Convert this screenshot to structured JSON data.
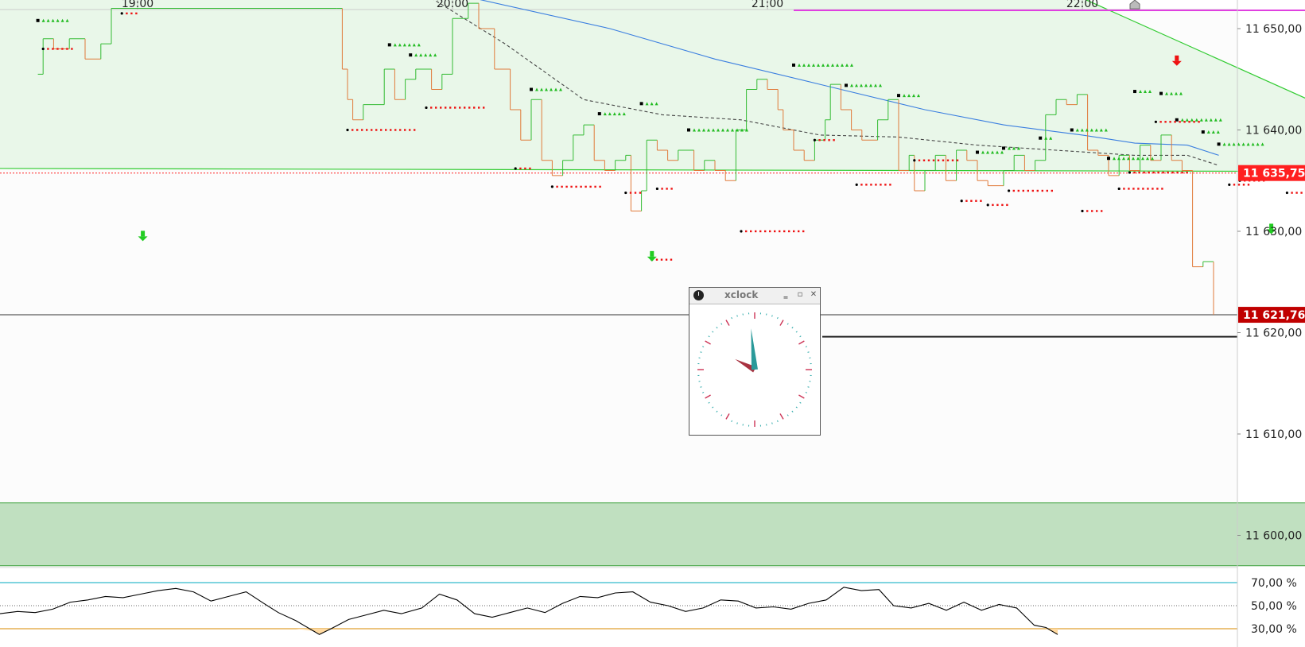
{
  "chart_data": {
    "type": "line",
    "time_axis": {
      "ticks": [
        "19:00",
        "20:00",
        "21:00",
        "22:00"
      ]
    },
    "price_axis": {
      "ticks": [
        "11 650,00",
        "11 640,00",
        "11 630,00",
        "11 620,00",
        "11 610,00",
        "11 600,00"
      ],
      "tick_values": [
        11650,
        11640,
        11630,
        11620,
        11610,
        11600
      ],
      "range": [
        11597,
        11653
      ],
      "current_price_label": "11 621,76",
      "reference_price_label": "11 635,75",
      "current_price": 11621.76,
      "reference_price": 11635.75,
      "support_level": 11619.6
    },
    "price_series": [
      {
        "t": "18:41",
        "v": 11645.5
      },
      {
        "t": "18:42",
        "v": 11649
      },
      {
        "t": "18:44",
        "v": 11648
      },
      {
        "t": "18:47",
        "v": 11649
      },
      {
        "t": "18:50",
        "v": 11647
      },
      {
        "t": "18:53",
        "v": 11648.5
      },
      {
        "t": "18:55",
        "v": 11652
      },
      {
        "t": "19:38",
        "v": 11652
      },
      {
        "t": "19:39",
        "v": 11646
      },
      {
        "t": "19:40",
        "v": 11643
      },
      {
        "t": "19:41",
        "v": 11641
      },
      {
        "t": "19:43",
        "v": 11642.5
      },
      {
        "t": "19:47",
        "v": 11646
      },
      {
        "t": "19:49",
        "v": 11643
      },
      {
        "t": "19:51",
        "v": 11645
      },
      {
        "t": "19:53",
        "v": 11646
      },
      {
        "t": "19:56",
        "v": 11644
      },
      {
        "t": "19:58",
        "v": 11645.5
      },
      {
        "t": "20:00",
        "v": 11651
      },
      {
        "t": "20:03",
        "v": 11652.5
      },
      {
        "t": "20:05",
        "v": 11650
      },
      {
        "t": "20:08",
        "v": 11646
      },
      {
        "t": "20:11",
        "v": 11642
      },
      {
        "t": "20:13",
        "v": 11639
      },
      {
        "t": "20:15",
        "v": 11643
      },
      {
        "t": "20:17",
        "v": 11637
      },
      {
        "t": "20:19",
        "v": 11635.5
      },
      {
        "t": "20:21",
        "v": 11637
      },
      {
        "t": "20:23",
        "v": 11639.5
      },
      {
        "t": "20:25",
        "v": 11640.5
      },
      {
        "t": "20:27",
        "v": 11637
      },
      {
        "t": "20:29",
        "v": 11636
      },
      {
        "t": "20:31",
        "v": 11637
      },
      {
        "t": "20:33",
        "v": 11637.5
      },
      {
        "t": "20:34",
        "v": 11632
      },
      {
        "t": "20:36",
        "v": 11634
      },
      {
        "t": "20:37",
        "v": 11639
      },
      {
        "t": "20:39",
        "v": 11638
      },
      {
        "t": "20:41",
        "v": 11637
      },
      {
        "t": "20:43",
        "v": 11638
      },
      {
        "t": "20:46",
        "v": 11636
      },
      {
        "t": "20:48",
        "v": 11637
      },
      {
        "t": "20:50",
        "v": 11636
      },
      {
        "t": "20:52",
        "v": 11635
      },
      {
        "t": "20:54",
        "v": 11640
      },
      {
        "t": "20:56",
        "v": 11644
      },
      {
        "t": "20:58",
        "v": 11645
      },
      {
        "t": "21:00",
        "v": 11644
      },
      {
        "t": "21:02",
        "v": 11642
      },
      {
        "t": "21:03",
        "v": 11640
      },
      {
        "t": "21:05",
        "v": 11638
      },
      {
        "t": "21:07",
        "v": 11637
      },
      {
        "t": "21:09",
        "v": 11639
      },
      {
        "t": "21:11",
        "v": 11641
      },
      {
        "t": "21:12",
        "v": 11644.5
      },
      {
        "t": "21:14",
        "v": 11642
      },
      {
        "t": "21:16",
        "v": 11640
      },
      {
        "t": "21:18",
        "v": 11639
      },
      {
        "t": "21:21",
        "v": 11641
      },
      {
        "t": "21:23",
        "v": 11643
      },
      {
        "t": "21:25",
        "v": 11636
      },
      {
        "t": "21:27",
        "v": 11637.5
      },
      {
        "t": "21:28",
        "v": 11634
      },
      {
        "t": "21:30",
        "v": 11636
      },
      {
        "t": "21:32",
        "v": 11637.5
      },
      {
        "t": "21:34",
        "v": 11635
      },
      {
        "t": "21:36",
        "v": 11638
      },
      {
        "t": "21:38",
        "v": 11637
      },
      {
        "t": "21:40",
        "v": 11635
      },
      {
        "t": "21:42",
        "v": 11634.5
      },
      {
        "t": "21:45",
        "v": 11636
      },
      {
        "t": "21:47",
        "v": 11637.5
      },
      {
        "t": "21:49",
        "v": 11636
      },
      {
        "t": "21:51",
        "v": 11637
      },
      {
        "t": "21:53",
        "v": 11641.5
      },
      {
        "t": "21:55",
        "v": 11643
      },
      {
        "t": "21:57",
        "v": 11642.5
      },
      {
        "t": "21:59",
        "v": 11643.5
      },
      {
        "t": "22:01",
        "v": 11638
      },
      {
        "t": "22:03",
        "v": 11637.5
      },
      {
        "t": "22:05",
        "v": 11635.5
      },
      {
        "t": "22:07",
        "v": 11637.5
      },
      {
        "t": "22:09",
        "v": 11636
      },
      {
        "t": "22:11",
        "v": 11638.5
      },
      {
        "t": "22:13",
        "v": 11637
      },
      {
        "t": "22:15",
        "v": 11639.5
      },
      {
        "t": "22:17",
        "v": 11637
      },
      {
        "t": "22:19",
        "v": 11636
      },
      {
        "t": "22:21",
        "v": 11626.5
      },
      {
        "t": "22:23",
        "v": 11627
      },
      {
        "t": "22:25",
        "v": 11621.76
      }
    ],
    "moving_average_blue": [
      {
        "t": "20:04",
        "v": 11653
      },
      {
        "t": "20:30",
        "v": 11650
      },
      {
        "t": "20:50",
        "v": 11647
      },
      {
        "t": "21:10",
        "v": 11644.5
      },
      {
        "t": "21:30",
        "v": 11642
      },
      {
        "t": "21:45",
        "v": 11640.5
      },
      {
        "t": "22:00",
        "v": 11639.5
      },
      {
        "t": "22:10",
        "v": 11638.7
      },
      {
        "t": "22:20",
        "v": 11638.5
      },
      {
        "t": "22:26",
        "v": 11637.5
      }
    ],
    "moving_average_dashed": [
      {
        "t": "19:56",
        "v": 11653
      },
      {
        "t": "20:10",
        "v": 11648.5
      },
      {
        "t": "20:25",
        "v": 11643
      },
      {
        "t": "20:40",
        "v": 11641.5
      },
      {
        "t": "20:55",
        "v": 11641
      },
      {
        "t": "21:10",
        "v": 11639.5
      },
      {
        "t": "21:25",
        "v": 11639.3
      },
      {
        "t": "21:40",
        "v": 11638.5
      },
      {
        "t": "21:55",
        "v": 11638
      },
      {
        "t": "22:10",
        "v": 11637.5
      },
      {
        "t": "22:20",
        "v": 11637.5
      },
      {
        "t": "22:26",
        "v": 11636.5
      }
    ],
    "trend_channel": {
      "upper": [
        {
          "t": "18:31",
          "v": 11653
        },
        {
          "t": "22:00",
          "v": 11653
        },
        {
          "t": "22:56",
          "v": 11640
        }
      ],
      "lower": [
        {
          "t": "18:31",
          "v": 11636.2
        },
        {
          "t": "22:56",
          "v": 11635.9
        }
      ]
    },
    "target_zone": {
      "t_start": "18:31",
      "t_end": "22:44",
      "low": 11597,
      "high": 11603.2
    },
    "magenta_line": {
      "t_start": "21:05",
      "t_end": "22:56",
      "v": 11653
    },
    "signals": {
      "sell_arrow_red": [
        {
          "t": "22:18",
          "v": 11646.8
        }
      ],
      "sell_arrow_green": [
        {
          "t": "19:01",
          "v": 11629.5
        },
        {
          "t": "20:38",
          "v": 11627.5
        },
        {
          "t": "22:36",
          "v": 11630.2
        }
      ],
      "marker_house": [
        {
          "t": "22:10",
          "v": 11652.5
        }
      ]
    },
    "green_triangle_runs": [
      {
        "t": "18:41",
        "v": 11650.8,
        "n": 6
      },
      {
        "t": "19:48",
        "v": 11648.4,
        "n": 6
      },
      {
        "t": "19:52",
        "v": 11647.4,
        "n": 5
      },
      {
        "t": "20:15",
        "v": 11644,
        "n": 6
      },
      {
        "t": "20:28",
        "v": 11641.6,
        "n": 5
      },
      {
        "t": "20:36",
        "v": 11642.6,
        "n": 3
      },
      {
        "t": "20:45",
        "v": 11640,
        "n": 12
      },
      {
        "t": "21:05",
        "v": 11646.4,
        "n": 12
      },
      {
        "t": "21:15",
        "v": 11644.4,
        "n": 7
      },
      {
        "t": "21:25",
        "v": 11643.4,
        "n": 4
      },
      {
        "t": "21:40",
        "v": 11637.8,
        "n": 5
      },
      {
        "t": "21:45",
        "v": 11638.2,
        "n": 3
      },
      {
        "t": "21:52",
        "v": 11639.2,
        "n": 2
      },
      {
        "t": "21:58",
        "v": 11640,
        "n": 7
      },
      {
        "t": "22:05",
        "v": 11637.2,
        "n": 9
      },
      {
        "t": "22:10",
        "v": 11643.8,
        "n": 3
      },
      {
        "t": "22:15",
        "v": 11643.6,
        "n": 4
      },
      {
        "t": "22:18",
        "v": 11641,
        "n": 9
      },
      {
        "t": "22:23",
        "v": 11639.8,
        "n": 3
      },
      {
        "t": "22:26",
        "v": 11638.6,
        "n": 9
      }
    ],
    "red_dot_runs": [
      {
        "t": "18:57",
        "v": 11651.5,
        "n": 3
      },
      {
        "t": "18:42",
        "v": 11648,
        "n": 6
      },
      {
        "t": "19:40",
        "v": 11640,
        "n": 14
      },
      {
        "t": "19:55",
        "v": 11642.2,
        "n": 12
      },
      {
        "t": "20:12",
        "v": 11636.2,
        "n": 3
      },
      {
        "t": "20:19",
        "v": 11634.4,
        "n": 10
      },
      {
        "t": "20:33",
        "v": 11633.8,
        "n": 3
      },
      {
        "t": "20:39",
        "v": 11634.2,
        "n": 3
      },
      {
        "t": "20:55",
        "v": 11630,
        "n": 13
      },
      {
        "t": "20:38",
        "v": 11627.2,
        "n": 4
      },
      {
        "t": "21:09",
        "v": 11639,
        "n": 4
      },
      {
        "t": "21:17",
        "v": 11634.6,
        "n": 7
      },
      {
        "t": "21:28",
        "v": 11637,
        "n": 9
      },
      {
        "t": "21:37",
        "v": 11633,
        "n": 4
      },
      {
        "t": "21:42",
        "v": 11632.6,
        "n": 4
      },
      {
        "t": "21:46",
        "v": 11634,
        "n": 9
      },
      {
        "t": "22:00",
        "v": 11632,
        "n": 4
      },
      {
        "t": "22:07",
        "v": 11634.2,
        "n": 9
      },
      {
        "t": "22:14",
        "v": 11640.8,
        "n": 9
      },
      {
        "t": "22:09",
        "v": 11635.8,
        "n": 12
      },
      {
        "t": "22:28",
        "v": 11634.6,
        "n": 4
      },
      {
        "t": "22:39",
        "v": 11633.8,
        "n": 11
      },
      {
        "t": "22:30",
        "v": 11635,
        "n": 5
      }
    ],
    "rsi": {
      "ticks": [
        "70,00 %",
        "50,00 %",
        "30,00 %"
      ],
      "tick_values": [
        70,
        50,
        30
      ],
      "upper_band": 70,
      "lower_band": 30,
      "range": [
        17,
        81
      ],
      "values": [
        {
          "t": "18:31",
          "v": 43
        },
        {
          "t": "18:37",
          "v": 45
        },
        {
          "t": "18:43",
          "v": 44
        },
        {
          "t": "18:49",
          "v": 47
        },
        {
          "t": "18:55",
          "v": 53
        },
        {
          "t": "19:01",
          "v": 55
        },
        {
          "t": "19:07",
          "v": 58
        },
        {
          "t": "19:13",
          "v": 57
        },
        {
          "t": "19:19",
          "v": 60
        },
        {
          "t": "19:25",
          "v": 63
        },
        {
          "t": "19:31",
          "v": 65
        },
        {
          "t": "19:37",
          "v": 62
        },
        {
          "t": "19:43",
          "v": 54
        },
        {
          "t": "19:49",
          "v": 58
        },
        {
          "t": "19:55",
          "v": 62
        },
        {
          "t": "20:01",
          "v": 52
        },
        {
          "t": "20:06",
          "v": 44
        },
        {
          "t": "20:12",
          "v": 37
        },
        {
          "t": "20:18",
          "v": 28
        },
        {
          "t": "20:20",
          "v": 25
        },
        {
          "t": "20:24",
          "v": 30
        },
        {
          "t": "20:30",
          "v": 38
        },
        {
          "t": "20:36",
          "v": 42
        },
        {
          "t": "20:42",
          "v": 46
        },
        {
          "t": "20:48",
          "v": 43
        },
        {
          "t": "20:55",
          "v": 48
        },
        {
          "t": "21:01",
          "v": 60
        },
        {
          "t": "21:07",
          "v": 55
        },
        {
          "t": "21:13",
          "v": 43
        },
        {
          "t": "21:19",
          "v": 40
        },
        {
          "t": "21:25",
          "v": 44
        },
        {
          "t": "21:31",
          "v": 48
        },
        {
          "t": "21:37",
          "v": 44
        },
        {
          "t": "21:43",
          "v": 52
        },
        {
          "t": "21:49",
          "v": 58
        },
        {
          "t": "21:55",
          "v": 57
        },
        {
          "t": "22:01",
          "v": 61
        },
        {
          "t": "22:07",
          "v": 62
        },
        {
          "t": "22:13",
          "v": 53
        },
        {
          "t": "22:19",
          "v": 50
        },
        {
          "t": "22:25",
          "v": 45
        },
        {
          "t": "22:31",
          "v": 48
        },
        {
          "t": "22:37",
          "v": 55
        },
        {
          "t": "22:43",
          "v": 54
        },
        {
          "t": "22:49",
          "v": 48
        },
        {
          "t": "22:55",
          "v": 49
        },
        {
          "t": "23:01",
          "v": 47
        },
        {
          "t": "23:07",
          "v": 52
        },
        {
          "t": "23:13",
          "v": 55
        },
        {
          "t": "23:19",
          "v": 66
        },
        {
          "t": "23:25",
          "v": 63
        },
        {
          "t": "23:31",
          "v": 64
        },
        {
          "t": "23:36",
          "v": 50
        },
        {
          "t": "23:42",
          "v": 48
        },
        {
          "t": "23:48",
          "v": 52
        },
        {
          "t": "23:54",
          "v": 46
        },
        {
          "t": "24:00",
          "v": 53
        },
        {
          "t": "24:06",
          "v": 46
        },
        {
          "t": "24:12",
          "v": 51
        },
        {
          "t": "24:18",
          "v": 48
        },
        {
          "t": "24:24",
          "v": 33
        },
        {
          "t": "24:28",
          "v": 31
        },
        {
          "t": "24:32",
          "v": 25
        }
      ]
    }
  },
  "colors": {
    "price_up": "#33bb33",
    "price_down": "#e07a3a",
    "moving_average_blue": "#3a7ee0",
    "moving_average_dashed": "#444444",
    "channel": "#33cc33",
    "channel_fill": "#e9f7e9",
    "target_zone": "#c0e0c0",
    "reference_line": "#ff2020",
    "reference_badge": "#ff2020",
    "current_badge": "#c00000",
    "magenta": "#e040e0",
    "signal_green": "#22cc22",
    "signal_red": "#ee1111",
    "rsi_line": "#000000",
    "rsi_upper": "#33bbcc",
    "rsi_lower": "#e0a030",
    "rsi_oversold_fill": "#ffd9a0"
  },
  "xclock": {
    "title": "xclock",
    "hour_hand_angle_deg": 298,
    "minute_hand_angle_deg": 355,
    "minimize_icon": "minimize-icon",
    "maximize_icon": "maximize-icon",
    "close_icon": "close-icon"
  }
}
